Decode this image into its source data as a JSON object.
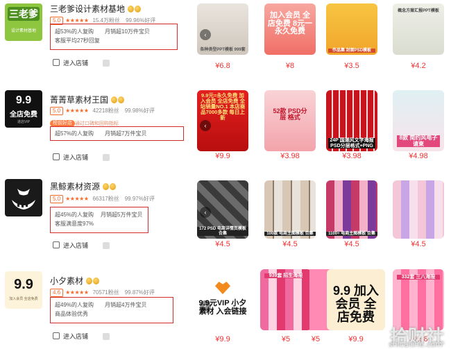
{
  "stores": [
    {
      "name": "三老爹设计素材基地",
      "score": "5.0",
      "stars": "★★★★★",
      "fans": "15.4万粉丝",
      "positive": "99.96%好评",
      "line1a": "超53%的人复购",
      "line1b": "月销超10万件宝贝",
      "line2": "客服平均27秒回复",
      "enter_label": "进入店铺",
      "logo_text_main": "三老爹",
      "logo_text_sub": "设计素材基地",
      "products": [
        {
          "price": "¥6.8",
          "text": "各种类型PPT模板 999套"
        },
        {
          "price": "¥8",
          "text": "加入会员 全店免费 8元一永久免费"
        },
        {
          "price": "¥3.5",
          "text": "作品集 封面PSD模板"
        },
        {
          "price": "¥4.2",
          "text": "概念方案汇报PPT模板"
        }
      ]
    },
    {
      "name": "菁菁草素材王国",
      "score": "5.0",
      "stars": "★★★★★",
      "fans": "42218粉丝",
      "positive": "99.98%好评",
      "hot_badge": "榜前好店",
      "hot_note": "通过口碑和回购指标",
      "line1a": "超57%的人复购",
      "line1b": "月销超7万件宝贝",
      "line2": "",
      "enter_label": "进入店铺",
      "logo_text_main": "9.9",
      "logo_text_sub": "全店免费",
      "logo_text_tag": "进店VIP",
      "products": [
        {
          "price": "¥9.9",
          "text": "9.9元=永久免费 加入会员 全店免费 全站销量NO.1 本店商品7000多款 每日上新"
        },
        {
          "price": "¥3.98",
          "text": "52款 PSD分层 格式"
        },
        {
          "price": "¥3.98",
          "text": "24P 国潮风文字海报 PSD分层格式+PNG"
        },
        {
          "price": "¥4.98",
          "text": "8款 简约风电子请柬"
        }
      ]
    },
    {
      "name": "黑鲸素材资源",
      "score": "5.0",
      "stars": "★★★★★",
      "fans": "66317粉丝",
      "positive": "99.97%好评",
      "line1a": "超45%的人复购",
      "line1b": "月销超5万件宝贝",
      "line2": "客服满意度97%",
      "enter_label": "进入店铺",
      "products": [
        {
          "price": "¥4.5",
          "text": "172 PSD 电商详情页模板 合集"
        },
        {
          "price": "¥4.5",
          "text": "100款 电商主图模板 合集"
        },
        {
          "price": "¥4.5",
          "text": "1100+ 电商主图模板 合集"
        },
        {
          "price": "¥4.5",
          "text": ""
        }
      ]
    },
    {
      "name": "小夕素材",
      "score": "4.6",
      "stars": "★★★★★",
      "fans": "70571粉丝",
      "positive": "99.87%好评",
      "line1a": "超49%的人复购",
      "line1b": "月销超4万件宝贝",
      "line2": "商品体验优秀",
      "enter_label": "进入店铺",
      "logo_text_main": "9.9",
      "logo_text_sub": "加入会员 全店免费",
      "products": [
        {
          "price": "¥9.9",
          "text": "9.9元VIP 小夕素材 入会链接"
        },
        {
          "price": "¥5",
          "text": "939套 招生海报"
        },
        {
          "price": "¥5",
          "text": ""
        },
        {
          "price": "¥9.9",
          "text": "9.9 加入会员 全店免费"
        },
        {
          "price": "¥4.98",
          "text": "332套 三八海报"
        }
      ]
    }
  ],
  "watermark": "拾财社",
  "watermark_sub": "shicaishe.com",
  "colors": {
    "accent": "#f23030",
    "highlight_box": "#d42a2a",
    "score": "#f36b2a"
  }
}
